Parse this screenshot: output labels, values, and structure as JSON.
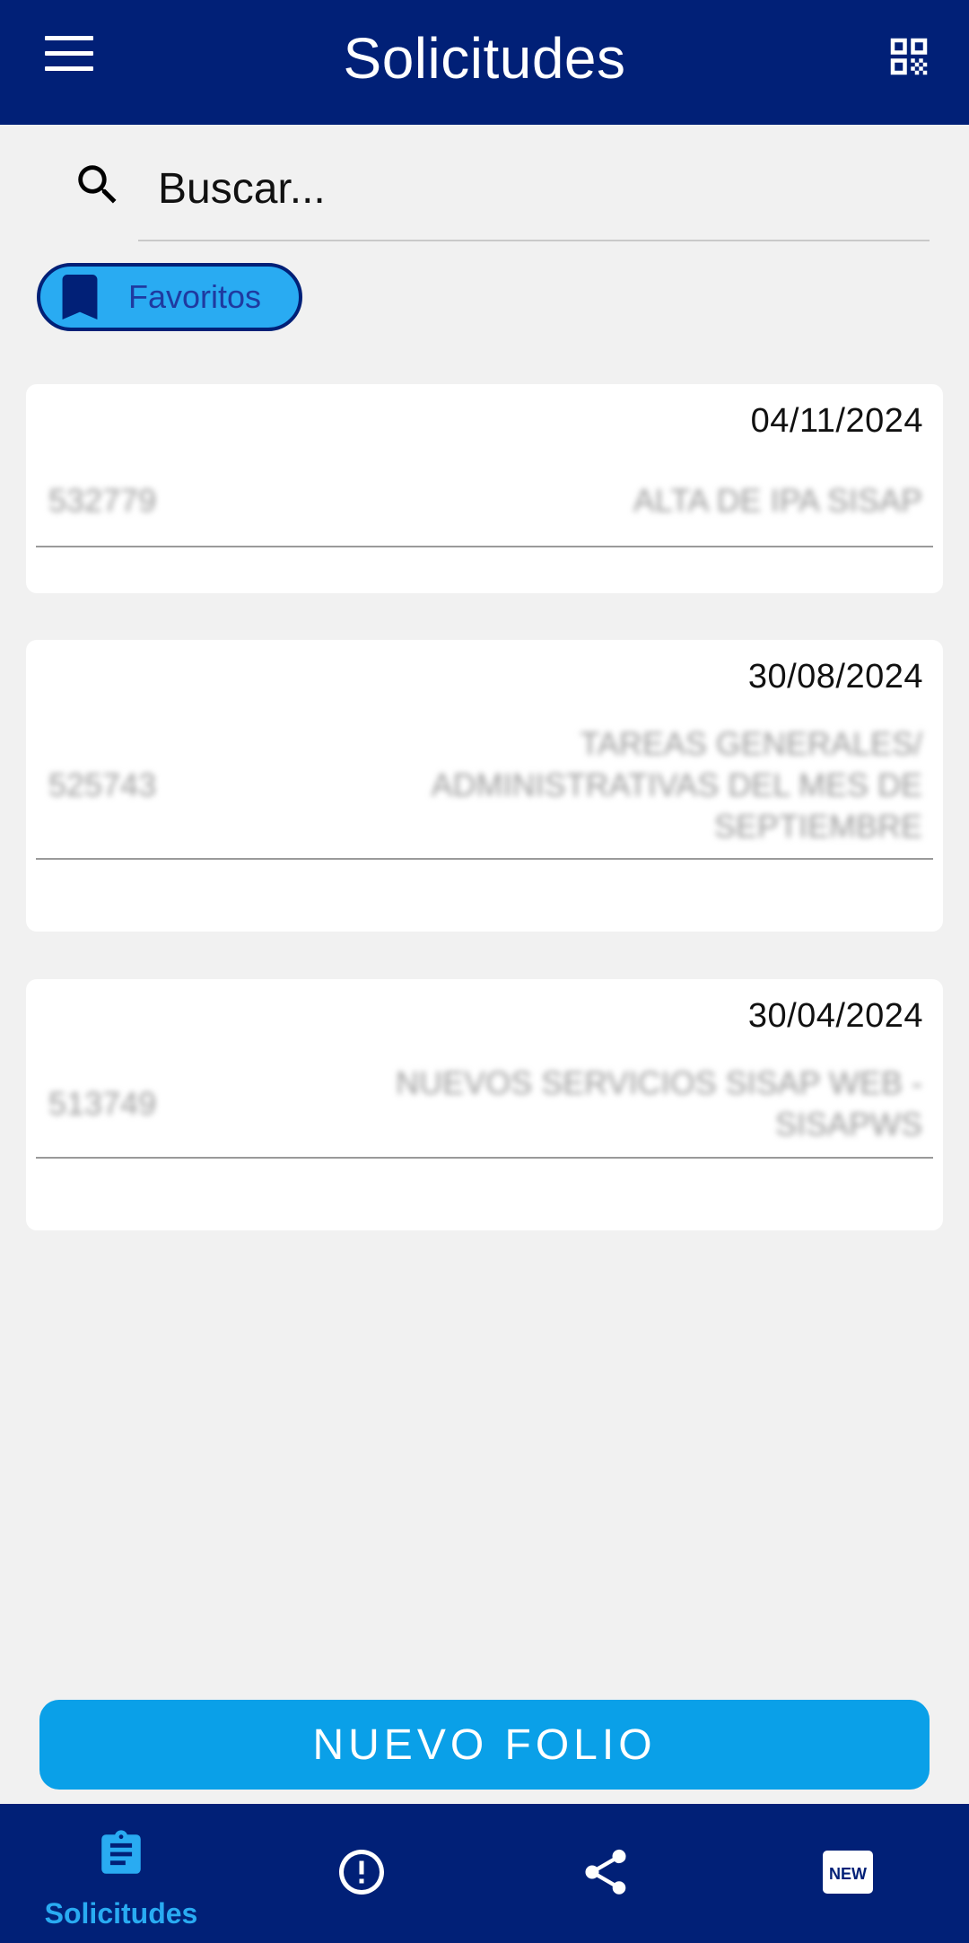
{
  "app_bar": {
    "title": "Solicitudes",
    "menu_icon": "menu-icon",
    "qr_icon": "qr-code-icon"
  },
  "search": {
    "placeholder": "Buscar...",
    "icon": "search-icon"
  },
  "filter_chip": {
    "label": "Favoritos",
    "icon": "bookmark-icon",
    "selected": true
  },
  "requests": [
    {
      "date": "04/11/2024",
      "folio": "532779",
      "description": "ALTA DE IPA SISAP"
    },
    {
      "date": "30/08/2024",
      "folio": "525743",
      "description": "TAREAS GENERALES/ ADMINISTRATIVAS  DEL MES DE SEPTIEMBRE"
    },
    {
      "date": "30/04/2024",
      "folio": "513749",
      "description": "NUEVOS SERVICIOS SISAP WEB - SISAPWS"
    }
  ],
  "new_folio_button": {
    "label": "NUEVO FOLIO"
  },
  "bottom_nav": {
    "items": [
      {
        "label": "Solicitudes",
        "icon": "clipboard-icon",
        "active": true
      },
      {
        "label": "",
        "icon": "alert-circle-icon",
        "active": false
      },
      {
        "label": "",
        "icon": "share-icon",
        "active": false
      },
      {
        "label": "",
        "icon": "new-badge-icon",
        "active": false
      }
    ]
  },
  "colors": {
    "primary_dark": "#012077",
    "accent": "#29abf2",
    "button": "#0aa0e8",
    "background": "#f1f1f1"
  }
}
